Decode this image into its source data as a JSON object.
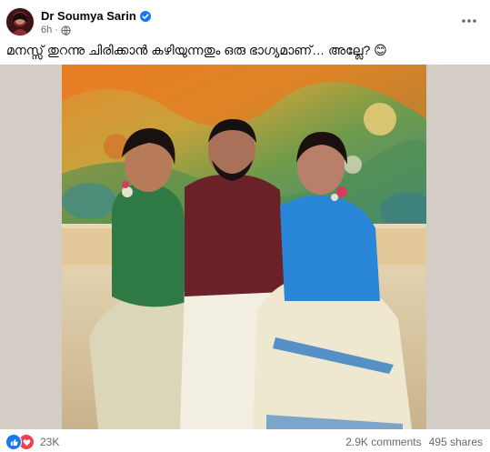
{
  "post": {
    "author": "Dr Soumya Sarin",
    "verified": true,
    "time": "6h",
    "privacy_icon": "globe-icon",
    "caption": "മനസ്സ് തുറന്നു ചിരിക്കാൻ കഴിയുന്നതും ഒരു ഭാഗ്യമാണ്… അല്ലേ? 😊",
    "more_icon": "more-options-icon"
  },
  "footer": {
    "reaction_icons": [
      "like-icon",
      "love-icon"
    ],
    "reaction_count": "23K",
    "comments": "2.9K comments",
    "shares": "495 shares"
  },
  "colors": {
    "brand_blue": "#1877f2",
    "love_red": "#f33e58",
    "meta_gray": "#65676b",
    "frame_bg": "#d4cdc5"
  }
}
